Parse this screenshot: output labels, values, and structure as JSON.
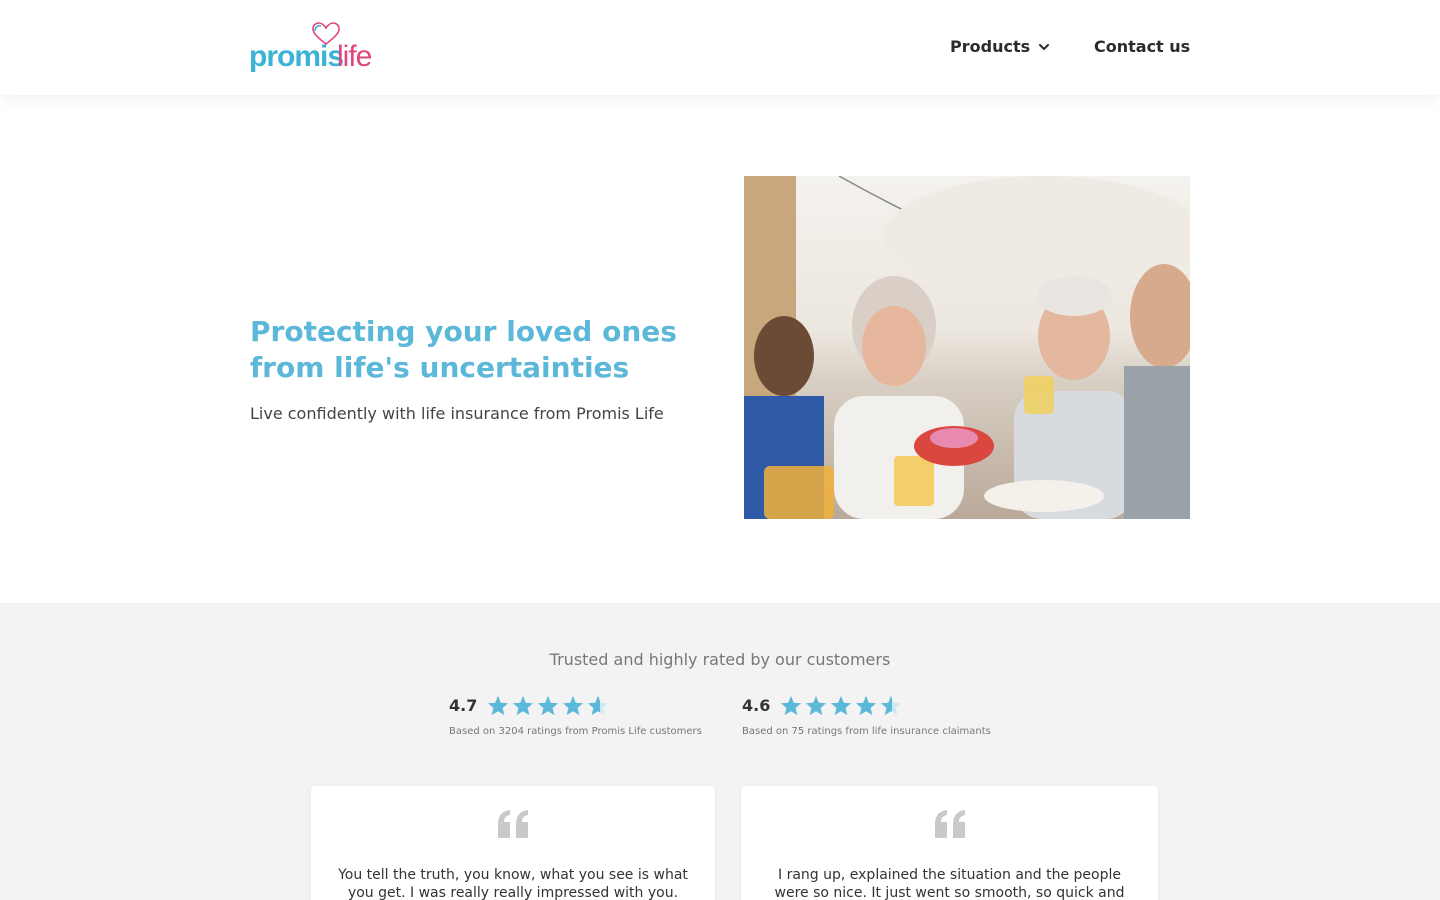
{
  "header": {
    "logo": {
      "text_a": "promis",
      "text_b": "life"
    },
    "nav": {
      "products_label": "Products",
      "contact_label": "Contact us"
    }
  },
  "hero": {
    "title": "Protecting your loved ones from life's uncertainties",
    "subtitle": "Live confidently with life insurance from Promis Life"
  },
  "ratings": {
    "heading": "Trusted and highly rated by our customers",
    "items": [
      {
        "score": "4.7",
        "stars": 4.7,
        "note": "Based on 3204 ratings from Promis Life customers"
      },
      {
        "score": "4.6",
        "stars": 4.6,
        "note": "Based on 75 ratings from life insurance claimants"
      }
    ]
  },
  "testimonials": [
    {
      "text": "You tell the truth, you know, what you see is what you get. I was really really impressed with you."
    },
    {
      "text": "I rang up, explained the situation and the people were so nice. It just went so smooth, so quick and"
    }
  ],
  "colors": {
    "brand_blue": "#5bb8d8",
    "brand_pink": "#e0457b",
    "star": "#5bb8d8",
    "section_bg": "#f3f3f3"
  }
}
